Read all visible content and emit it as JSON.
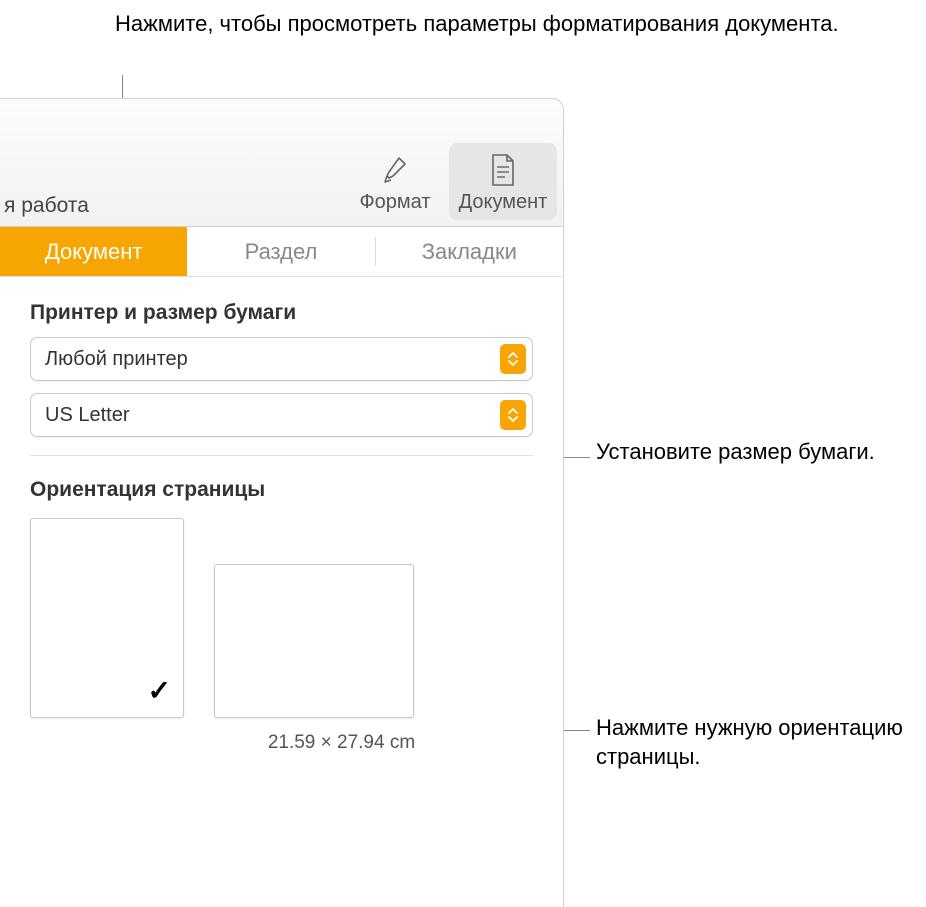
{
  "callouts": {
    "top": "Нажмите, чтобы просмотреть параметры форматирования документа.",
    "paperSize": "Установите размер бумаги.",
    "orientation": "Нажмите нужную ориентацию страницы."
  },
  "toolbar": {
    "leftPartial": "я работа",
    "format": "Формат",
    "document": "Документ"
  },
  "tabs": {
    "document": "Документ",
    "section": "Раздел",
    "bookmarks": "Закладки"
  },
  "printer": {
    "title": "Принтер и размер бумаги",
    "printerValue": "Любой принтер",
    "paperValue": "US Letter"
  },
  "orientation": {
    "title": "Ориентация страницы",
    "dimensions": "21.59 × 27.94 cm",
    "checkmark": "✓"
  }
}
